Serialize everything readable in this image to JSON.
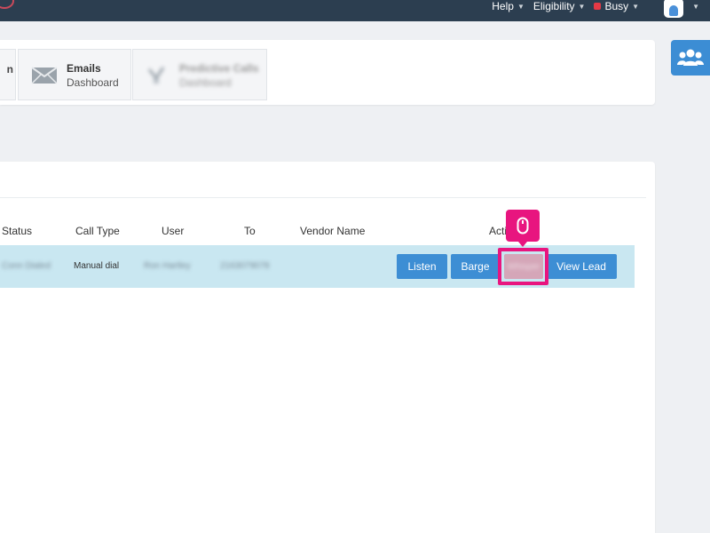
{
  "topnav": {
    "help_label": "Help",
    "eligibility_label": "Eligibility",
    "busy_label": "Busy"
  },
  "tiles": {
    "partial_label": "n",
    "emails_title": "Emails",
    "emails_sub": "Dashboard",
    "analytics_title": "Predictive Calls",
    "analytics_sub": "Dashboard"
  },
  "table": {
    "headers": [
      "Status",
      "Call Type",
      "User",
      "To",
      "Vendor Name",
      "Acti"
    ],
    "row": {
      "status": "Conn Dialed",
      "call_type": "Manual dial",
      "user": "Ron Hartley",
      "to": "2163079078",
      "vendor": ""
    },
    "actions": {
      "listen": "Listen",
      "barge": "Barge",
      "hidden": "Whisper",
      "view_lead": "View Lead"
    }
  },
  "colors": {
    "topbar": "#2c3e50",
    "button": "#3d8ed4",
    "row_highlight": "#c9e7f1",
    "annotation": "#e8157f"
  },
  "icons": [
    "envelope-icon",
    "chart-icon",
    "users-icon",
    "mouse-icon",
    "avatar-icon"
  ]
}
